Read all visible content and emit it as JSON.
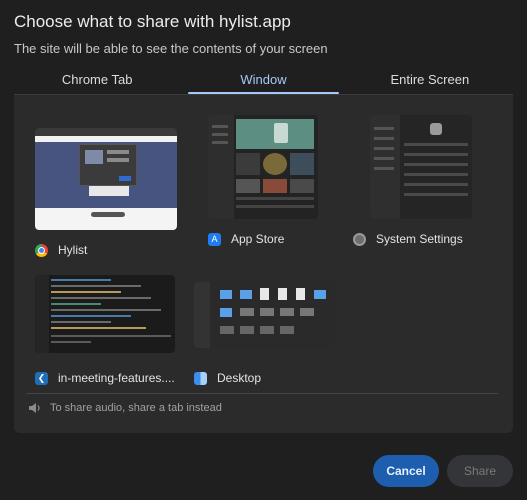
{
  "dialog": {
    "title": "Choose what to share with hylist.app",
    "subtitle": "The site will be able to see the contents of your screen"
  },
  "tabs": [
    {
      "label": "Chrome Tab",
      "active": false
    },
    {
      "label": "Window",
      "active": true
    },
    {
      "label": "Entire Screen",
      "active": false
    }
  ],
  "sources": [
    {
      "label": "Hylist",
      "icon": "chrome-icon"
    },
    {
      "label": "App Store",
      "icon": "app-store-icon"
    },
    {
      "label": "System Settings",
      "icon": "system-settings-icon"
    },
    {
      "label": "in-meeting-features....",
      "icon": "vscode-icon"
    },
    {
      "label": "Desktop",
      "icon": "finder-icon"
    }
  ],
  "audio_hint": "To share audio, share a tab instead",
  "buttons": {
    "cancel": "Cancel",
    "share": "Share"
  },
  "colors": {
    "accent": "#a8c7fa",
    "primary_button": "#1d5fae",
    "background": "#1f1f1f",
    "panel": "#2b2b2b"
  }
}
